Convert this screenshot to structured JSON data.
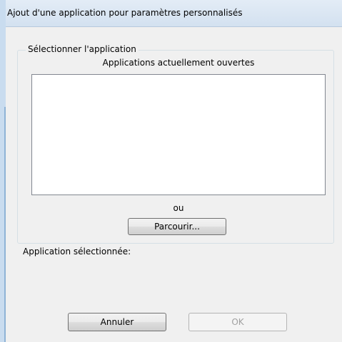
{
  "window": {
    "title": "Ajout d'une application pour paramètres personnalisés"
  },
  "select_group": {
    "legend": "Sélectionner l'application",
    "list_caption": "Applications actuellement ouvertes",
    "open_applications": [],
    "or_label": "ou",
    "browse_label": "Parcourir..."
  },
  "selected_application": {
    "label": "Application sélectionnée:",
    "value": ""
  },
  "footer": {
    "cancel_label": "Annuler",
    "ok_label": "OK",
    "ok_enabled": false
  },
  "colors": {
    "title_bar": "#d3e1f0",
    "dialog_background": "#f0f0f0",
    "disabled_text": "#a0a0a0"
  }
}
